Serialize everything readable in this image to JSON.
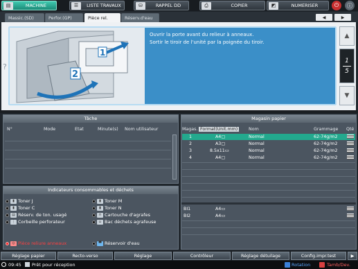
{
  "topbar": {
    "machine": "MACHINE",
    "job_list": "LISTE TRAVAUX",
    "recall_hdd": "RAPPEL DD",
    "copier": "COPIER",
    "scanner": "NUMERISER"
  },
  "tabs": [
    "Massic.(SD)",
    "Perfor.(GP)",
    "Pièce rel.",
    "Réserv.d'eau"
  ],
  "nav": {
    "prev": "◀",
    "next": "▶"
  },
  "guide": {
    "help": "?",
    "message_line1": "Ouvrir la porte avant du relieur à anneaux.",
    "message_line2": "Sortir le tiroir de l'unité par la poignée du tiroir.",
    "step1": "1",
    "step2": "2",
    "page_current": "1",
    "page_total": "5"
  },
  "job": {
    "title": "Tâche",
    "columns": [
      "N°",
      "Mode",
      "Etat",
      "Minute(s)",
      "Nom utilisateur"
    ]
  },
  "consumables": {
    "title": "Indicateurs consommables et déchets",
    "left": [
      "Toner J",
      "Toner C",
      "Réserv. de ton. usagé",
      "Corbeille perforateur"
    ],
    "right": [
      "Toner M",
      "Toner N",
      "Cartouche d'agrafes",
      "Bac déchets agrafeuse"
    ],
    "alert": "Pièce reliure anneaux",
    "water": "Réservoir d'eau"
  },
  "tray": {
    "title": "Magasin papier",
    "columns": [
      "Magas.",
      "Format(Unit.mm)",
      "Nom",
      "Grammage",
      "Qté"
    ],
    "rows": [
      {
        "num": "1",
        "format": "A4▢",
        "name": "Normal",
        "weight": "62-74g/m2"
      },
      {
        "num": "2",
        "format": "A3▢",
        "name": "Normal",
        "weight": "62-74g/m2"
      },
      {
        "num": "3",
        "format": "8.5x11▭",
        "name": "Normal",
        "weight": "62-74g/m2"
      },
      {
        "num": "4",
        "format": "A4▢",
        "name": "Normal",
        "weight": "62-74g/m2"
      }
    ],
    "bypass": [
      {
        "num": "BI1",
        "format": "A4▭"
      },
      {
        "num": "BI2",
        "format": "A4▭"
      }
    ]
  },
  "bottom_tabs": [
    "Réglage papier",
    "Recto-verso",
    "Réglage",
    "Contrôleur",
    "Réglage détuilage",
    "Config.impr.test"
  ],
  "status": {
    "time": "09:45",
    "text": "Prêt pour réception",
    "rotation": "Rotation",
    "transfer": "Tamb/Dev."
  },
  "colors": {
    "selected_tab": "#3fc9b0",
    "guide_blue": "#3b8fc8",
    "tray_selected": "#23a98e",
    "alert": "#ff4040"
  }
}
